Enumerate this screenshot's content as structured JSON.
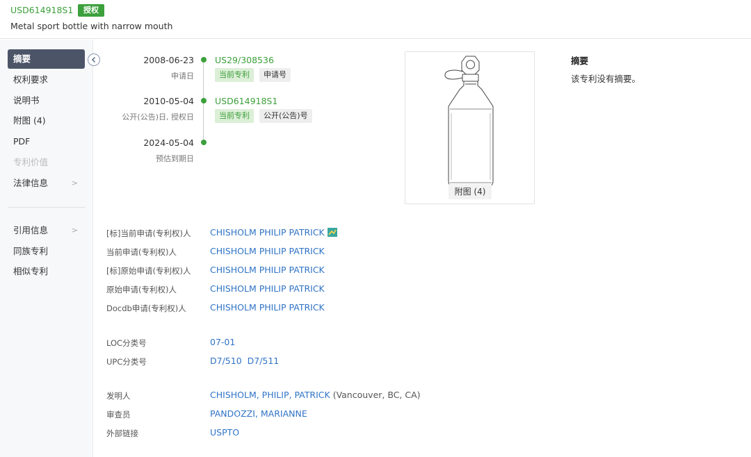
{
  "header": {
    "patent_number": "USD614918S1",
    "status_badge": "授权",
    "title": "Metal sport bottle with narrow mouth"
  },
  "sidebar": {
    "collapse_icon": "chevron-left-icon",
    "items": [
      {
        "label": "摘要",
        "active": true
      },
      {
        "label": "权利要求"
      },
      {
        "label": "说明书"
      },
      {
        "label": "附图 (4)"
      },
      {
        "label": "PDF"
      },
      {
        "label": "专利价值",
        "disabled": true
      },
      {
        "label": "法律信息",
        "chevron": true
      },
      {
        "label": "引用信息",
        "chevron": true
      },
      {
        "label": "同族专利"
      },
      {
        "label": "相似专利"
      }
    ],
    "chevron_glyph": ">"
  },
  "timeline": {
    "events": [
      {
        "date": "2008-06-23",
        "label": "申请日",
        "link": "US29/308536",
        "tags": [
          "当前专利",
          "申请号"
        ]
      },
      {
        "date": "2010-05-04",
        "label": "公开(公告)日, 授权日",
        "link": "USD614918S1",
        "tags": [
          "当前专利",
          "公开(公告)号"
        ]
      },
      {
        "date": "2024-05-04",
        "label": "预估到期日"
      }
    ],
    "dot_color": "#3ca03c"
  },
  "figure": {
    "caption": "附图 (4)"
  },
  "abstract": {
    "title": "摘要",
    "text": "该专利没有摘要。"
  },
  "applicants": [
    {
      "label": "[标]当前申请(专利权)人",
      "value": "CHISHOLM PHILIP PATRICK",
      "icon": "company-icon"
    },
    {
      "label": "当前申请(专利权)人",
      "value": "CHISHOLM PHILIP PATRICK"
    },
    {
      "label": "[标]原始申请(专利权)人",
      "value": "CHISHOLM PHILIP PATRICK"
    },
    {
      "label": "原始申请(专利权)人",
      "value": "CHISHOLM PHILIP PATRICK"
    },
    {
      "label": "Docdb申请(专利权)人",
      "value": "CHISHOLM PHILIP PATRICK"
    }
  ],
  "classification": [
    {
      "label": "LOC分类号",
      "values": [
        "07-01"
      ]
    },
    {
      "label": "UPC分类号",
      "values": [
        "D7/510",
        "D7/511"
      ]
    }
  ],
  "people": [
    {
      "label": "发明人",
      "value": "CHISHOLM, PHILIP, PATRICK",
      "extra": "(Vancouver, BC, CA)"
    },
    {
      "label": "审查员",
      "value": "PANDOZZI, MARIANNE"
    },
    {
      "label": "外部链接",
      "value": "USPTO"
    }
  ],
  "colors": {
    "accent_green": "#3ca03c",
    "link_blue": "#2f73c6",
    "sidebar_active": "#4c5568"
  }
}
